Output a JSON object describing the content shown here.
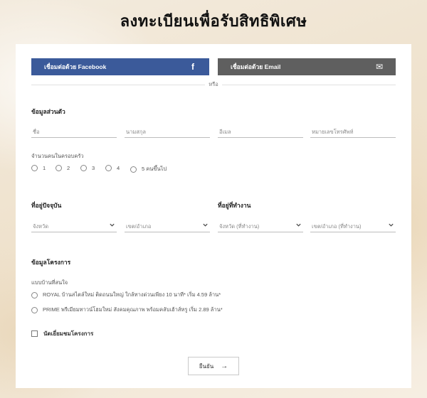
{
  "page": {
    "title": "ลงทะเบียนเพื่อรับสิทธิพิเศษ"
  },
  "social": {
    "facebook_label": "เชื่อมต่อด้วย Facebook",
    "facebook_icon": "f",
    "email_label": "เชื่อมต่อด้วย Email",
    "email_icon": "✉",
    "or_text": "หรือ"
  },
  "personal": {
    "heading": "ข้อมูลส่วนตัว",
    "first_name_placeholder": "ชื่อ",
    "last_name_placeholder": "นามสกุล",
    "email_placeholder": "อีเมล",
    "phone_placeholder": "หมายเลขโทรศัพท์",
    "family_label": "จำนวนคนในครอบครัว",
    "family_options": [
      "1",
      "2",
      "3",
      "4",
      "5 คนขึ้นไป"
    ]
  },
  "address": {
    "current_heading": "ที่อยู่ปัจจุบัน",
    "work_heading": "ที่อยู่ที่ทำงาน",
    "province_placeholder": "จังหวัด",
    "district_placeholder": "เขต/อำเภอ",
    "work_province_placeholder": "จังหวัด (ที่ทำงาน)",
    "work_district_placeholder": "เขต/อำเภอ (ที่ทำงาน)"
  },
  "project": {
    "heading": "ข้อมูลโครงการ",
    "interest_label": "แบบบ้านที่สนใจ",
    "options": [
      "ROYAL บ้านสไตล์ใหม่ ติดถนนใหญ่ ใกล้ทางด่วนเพียง 10 นาที* เริ่ม 4.59 ล้าน*",
      "PRIME พรีเมียมทาวน์โฮมใหม่ สังคมคุณภาพ พร้อมคลับเฮ้าส์หรู เริ่ม 2.89 ล้าน*"
    ],
    "appointment_label": "นัดเยี่ยมชมโครงการ"
  },
  "submit": {
    "label": "ยืนยัน",
    "icon": "→"
  },
  "colors": {
    "facebook": "#3b5a9a",
    "email": "#5f5f5f"
  }
}
